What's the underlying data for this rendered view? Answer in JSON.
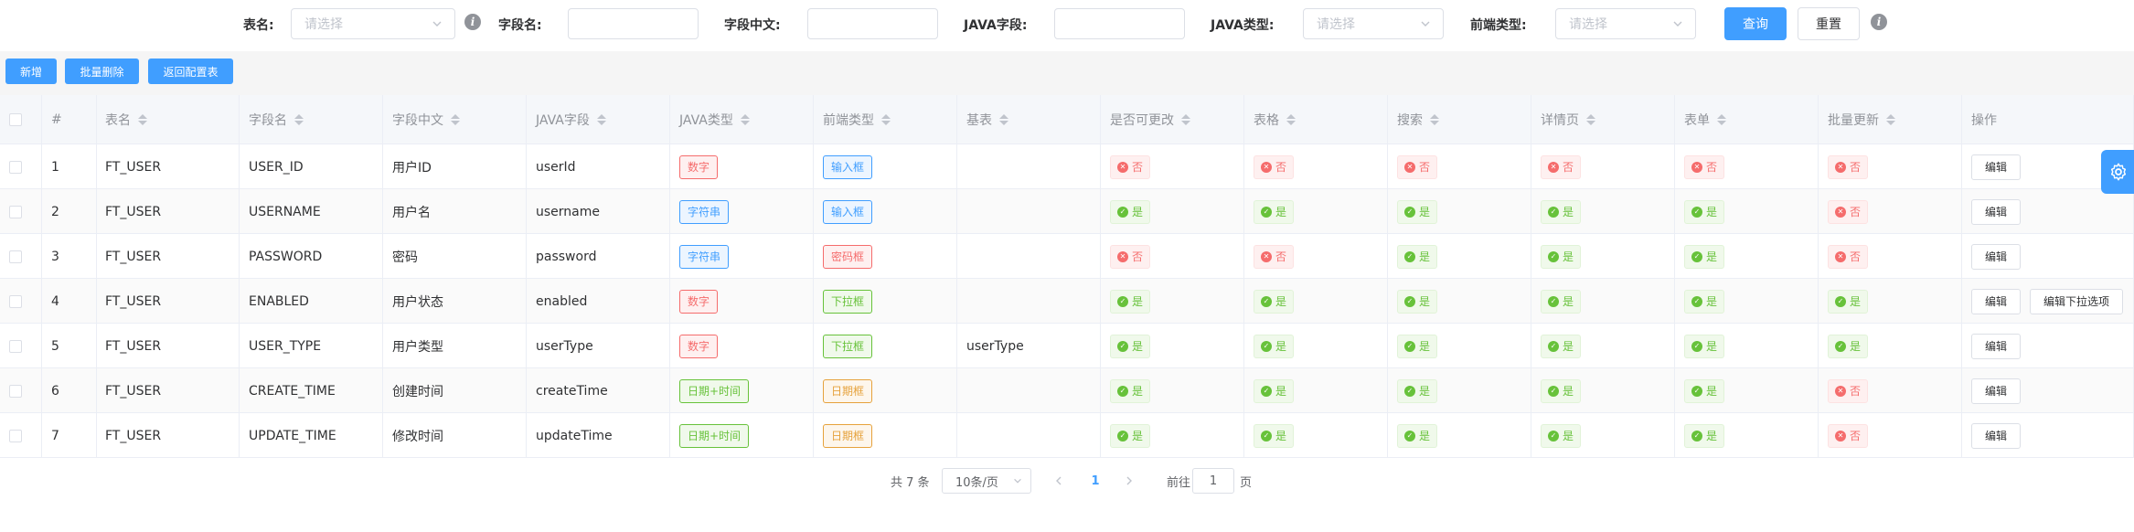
{
  "search": {
    "table_name_label": "表名:",
    "table_name_placeholder": "请选择",
    "field_name_label": "字段名:",
    "field_cn_label": "字段中文:",
    "java_field_label": "JAVA字段:",
    "java_type_label": "JAVA类型:",
    "java_type_placeholder": "请选择",
    "frontend_type_label": "前端类型:",
    "frontend_type_placeholder": "请选择",
    "query_label": "查询",
    "reset_label": "重置",
    "info_glyph": "i"
  },
  "toolbar": {
    "add_label": "新增",
    "batch_delete_label": "批量删除",
    "back_label": "返回配置表"
  },
  "table": {
    "headers": [
      "#",
      "表名",
      "字段名",
      "字段中文",
      "JAVA字段",
      "JAVA类型",
      "前端类型",
      "基表",
      "是否可更改",
      "表格",
      "搜索",
      "详情页",
      "表单",
      "批量更新",
      "操作"
    ],
    "yes_label": "是",
    "no_label": "否",
    "edit_label": "编辑",
    "edit_options_label": "编辑下拉选项",
    "rows": [
      {
        "index": "1",
        "table": "FT_USER",
        "field": "USER_ID",
        "cn": "用户ID",
        "java": "userId",
        "java_type": "数字",
        "java_type_color": "red",
        "fe_type": "输入框",
        "fe_type_color": "blue",
        "base": "",
        "editable": false,
        "grid": false,
        "search": false,
        "detail": false,
        "form": false,
        "batch": false,
        "edit_options": false
      },
      {
        "index": "2",
        "table": "FT_USER",
        "field": "USERNAME",
        "cn": "用户名",
        "java": "username",
        "java_type": "字符串",
        "java_type_color": "blue",
        "fe_type": "输入框",
        "fe_type_color": "blue",
        "base": "",
        "editable": true,
        "grid": true,
        "search": true,
        "detail": true,
        "form": true,
        "batch": false,
        "edit_options": false
      },
      {
        "index": "3",
        "table": "FT_USER",
        "field": "PASSWORD",
        "cn": "密码",
        "java": "password",
        "java_type": "字符串",
        "java_type_color": "blue",
        "fe_type": "密码框",
        "fe_type_color": "red",
        "base": "",
        "editable": false,
        "grid": false,
        "search": true,
        "detail": true,
        "form": true,
        "batch": false,
        "edit_options": false
      },
      {
        "index": "4",
        "table": "FT_USER",
        "field": "ENABLED",
        "cn": "用户状态",
        "java": "enabled",
        "java_type": "数字",
        "java_type_color": "red",
        "fe_type": "下拉框",
        "fe_type_color": "green",
        "base": "",
        "editable": true,
        "grid": true,
        "search": true,
        "detail": true,
        "form": true,
        "batch": true,
        "edit_options": true
      },
      {
        "index": "5",
        "table": "FT_USER",
        "field": "USER_TYPE",
        "cn": "用户类型",
        "java": "userType",
        "java_type": "数字",
        "java_type_color": "red",
        "fe_type": "下拉框",
        "fe_type_color": "green",
        "base": "userType",
        "editable": true,
        "grid": true,
        "search": true,
        "detail": true,
        "form": true,
        "batch": true,
        "edit_options": false
      },
      {
        "index": "6",
        "table": "FT_USER",
        "field": "CREATE_TIME",
        "cn": "创建时间",
        "java": "createTime",
        "java_type": "日期+时间",
        "java_type_color": "green",
        "fe_type": "日期框",
        "fe_type_color": "orange",
        "base": "",
        "editable": true,
        "grid": true,
        "search": true,
        "detail": true,
        "form": true,
        "batch": false,
        "edit_options": false
      },
      {
        "index": "7",
        "table": "FT_USER",
        "field": "UPDATE_TIME",
        "cn": "修改时间",
        "java": "updateTime",
        "java_type": "日期+时间",
        "java_type_color": "green",
        "fe_type": "日期框",
        "fe_type_color": "orange",
        "base": "",
        "editable": true,
        "grid": true,
        "search": true,
        "detail": true,
        "form": true,
        "batch": false,
        "edit_options": false
      }
    ]
  },
  "pagination": {
    "total_label": "共 7 条",
    "page_size_label": "10条/页",
    "current_page": "1",
    "goto_prefix": "前往",
    "goto_value": "1",
    "goto_suffix": "页"
  },
  "colors": {
    "primary": "#409eff",
    "success": "#67c23a",
    "danger": "#f56c6c",
    "warning": "#e6a23c"
  },
  "icons": {
    "settings": "gear-icon",
    "info": "info-icon",
    "dropdown": "chevron-down-icon",
    "yes": "check-circle-icon",
    "no": "close-circle-icon"
  }
}
